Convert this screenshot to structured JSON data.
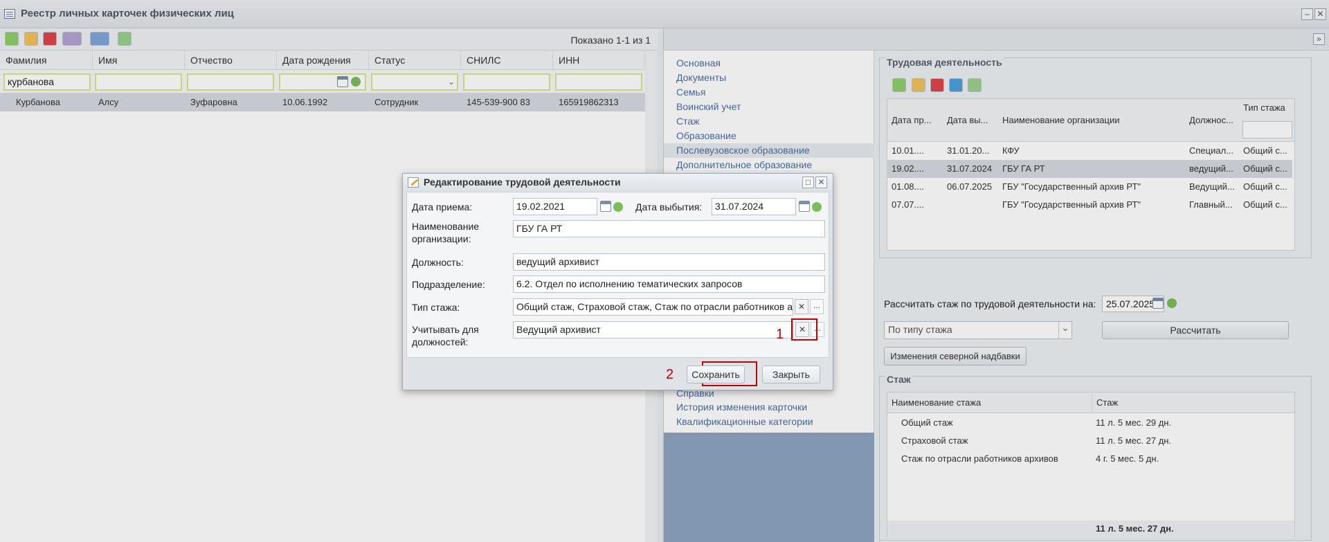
{
  "window": {
    "title": "Реестр личных карточек физических лиц"
  },
  "left": {
    "shown": "Показано 1-1 из 1",
    "columns": [
      "Фамилия",
      "Имя",
      "Отчество",
      "Дата рождения",
      "Статус",
      "СНИЛС",
      "ИНН"
    ],
    "filter_surname": "курбанова",
    "row": [
      "Курбанова",
      "Алсу",
      "Зуфаровна",
      "10.06.1992",
      "Сотрудник",
      "145-539-900 83",
      "165919862313"
    ]
  },
  "nav": {
    "items": [
      "Основная",
      "Документы",
      "Семья",
      "Воинский учет",
      "Стаж",
      "Образование",
      "Послевузовское образование",
      "Дополнительное образование",
      "Справки",
      "История изменения карточки",
      "Квалификационные категории"
    ],
    "selected": "Стаж"
  },
  "work_history": {
    "title": "Трудовая деятельность",
    "columns": [
      "Дата пр...",
      "Дата вы...",
      "Наименование организации",
      "Должнос...",
      "Тип стажа"
    ],
    "rows": [
      [
        "10.01....",
        "31.01.20...",
        "КФУ",
        "Специал...",
        "Общий с..."
      ],
      [
        "19.02....",
        "31.07.2024",
        "ГБУ ГА РТ",
        "ведущий...",
        "Общий с..."
      ],
      [
        "01.08....",
        "06.07.2025",
        "ГБУ \"Государственный архив РТ\"",
        "Ведущий...",
        "Общий с..."
      ],
      [
        "07.07....",
        "",
        "ГБУ \"Государственный архив РТ\"",
        "Главный...",
        "Общий с..."
      ]
    ]
  },
  "calc": {
    "label": "Рассчитать стаж по трудовой деятельности на:",
    "date": "25.07.2025",
    "type_select": "По типу стажа",
    "calc_button": "Рассчитать",
    "north_button": "Изменения северной надбавки"
  },
  "stazh": {
    "title": "Стаж",
    "columns": [
      "Наименование стажа",
      "Стаж"
    ],
    "rows": [
      [
        "Общий стаж",
        "11 л. 5 мес. 29 дн."
      ],
      [
        "Страховой стаж",
        "11 л. 5 мес. 27 дн."
      ],
      [
        "Стаж по отрасли работников архивов",
        "4 г. 5 мес. 5 дн."
      ]
    ],
    "total": "11 л. 5 мес. 27 дн."
  },
  "dialog": {
    "title": "Редактирование трудовой деятельности",
    "hire_label": "Дата приема:",
    "hire_value": "19.02.2021",
    "leave_label": "Дата выбытия:",
    "leave_value": "31.07.2024",
    "org_label": "Наименование организации:",
    "org_value": "ГБУ ГА РТ",
    "pos_label": "Должность:",
    "pos_value": "ведущий архивист",
    "dept_label": "Подразделение:",
    "dept_value": "6.2. Отдел по исполнению тематических запросов",
    "type_label": "Тип стажа:",
    "type_value": "Общий стаж, Страховой стаж, Стаж по отрасли работников архивов",
    "consider_label": "Учитывать для должностей:",
    "consider_value": "Ведущий архивист",
    "save": "Сохранить",
    "close": "Закрыть",
    "marker1": "1",
    "marker2": "2",
    "x_glyph": "✕",
    "dots_glyph": "..."
  }
}
